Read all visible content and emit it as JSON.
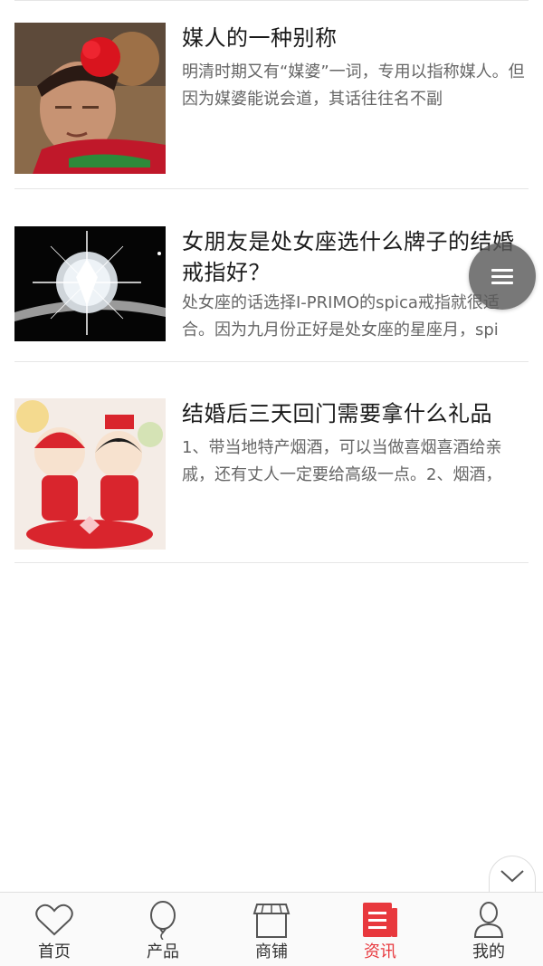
{
  "articles": [
    {
      "title": "媒人的一种别称",
      "summary": "明清时期又有“媒婆”一词，专用以指称媒人。但因为媒婆能说会道，其话往往名不副",
      "image": "matchmaker-photo"
    },
    {
      "title": "女朋友是处女座选什么牌子的结婚戒指好？",
      "summary": "处女座的话选择I-PRIMO的spica戒指就很适合。因为九月份正好是处女座的星座月，spi",
      "image": "diamond-ring-photo"
    },
    {
      "title": "结婚后三天回门需要拿什么礼品",
      "summary": "1、带当地特产烟酒，可以当做喜烟喜酒给亲戚，还有丈人一定要给高级一点。2、烟酒，",
      "image": "wedding-couple-figurine-photo"
    }
  ],
  "tabbar": {
    "items": [
      {
        "label": "首页",
        "icon": "heart-icon",
        "active": false
      },
      {
        "label": "产品",
        "icon": "balloon-icon",
        "active": false
      },
      {
        "label": "商铺",
        "icon": "store-icon",
        "active": false
      },
      {
        "label": "资讯",
        "icon": "news-icon",
        "active": true
      },
      {
        "label": "我的",
        "icon": "user-icon",
        "active": false
      }
    ]
  },
  "colors": {
    "accent": "#e8383d",
    "title": "#1a1a1a",
    "summary": "#666666",
    "divider": "#e6e6e6"
  }
}
